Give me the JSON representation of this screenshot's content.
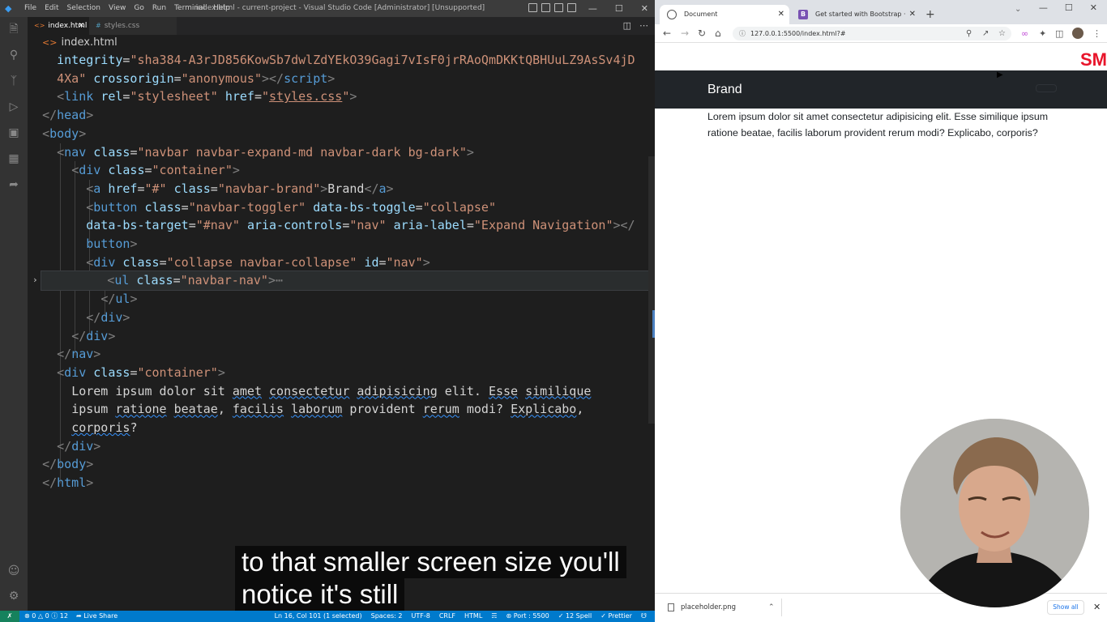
{
  "vscode": {
    "menu": [
      "File",
      "Edit",
      "Selection",
      "View",
      "Go",
      "Run",
      "Terminal",
      "Help"
    ],
    "window_title": "index.html - current-project - Visual Studio Code [Administrator] [Unsupported]",
    "tabs": [
      {
        "label": "index.html",
        "active": true
      },
      {
        "label": "styles.css",
        "active": false
      }
    ],
    "breadcrumb": "index.html",
    "status": {
      "errors": "0",
      "warnings": "0",
      "info": "12",
      "live_share": "Live Share",
      "position": "Ln 16, Col 101 (1 selected)",
      "spaces": "Spaces: 2",
      "encoding": "UTF-8",
      "eol": "CRLF",
      "language": "HTML",
      "port": "Port : 5500",
      "spell": "12 Spell",
      "prettier": "Prettier"
    }
  },
  "browser": {
    "tabs": [
      {
        "title": "Document",
        "active": true
      },
      {
        "title": "Get started with Bootstrap · Boot",
        "active": false
      }
    ],
    "url": "127.0.0.1:5500/index.html?#",
    "page": {
      "logo": "SM",
      "brand": "Brand",
      "text": "Lorem ipsum dolor sit amet consectetur adipisicing elit. Esse similique ipsum ratione beatae, facilis laborum provident rerum modi? Explicabo, corporis?"
    },
    "download": {
      "file": "placeholder.png",
      "show_all": "Show all"
    }
  },
  "captions": [
    "to that smaller screen size you'll",
    "notice it's still"
  ]
}
